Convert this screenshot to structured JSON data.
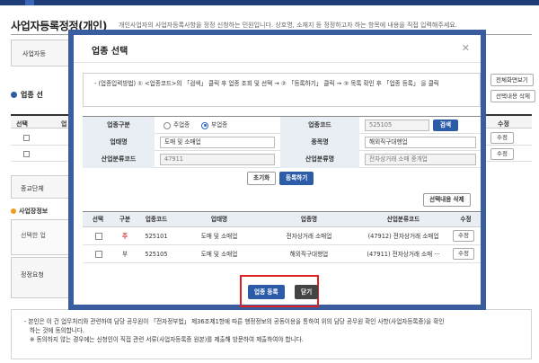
{
  "page": {
    "title": "사업자등록정정(개인)",
    "description": "개인사업자의 사업자등록사항을 정정 신청하는 민원입니다. 상호명, 소재지 등 정정하고자 하는 항목에 내용을 직접 입력해주세요."
  },
  "background": {
    "box1_label": "사업자등",
    "section_title": "업종 선",
    "preview_button": "전체화면보기",
    "delete_button": "선택내용 삭제",
    "table_headers": [
      "선택",
      "업"
    ],
    "edit_label": "수정",
    "box2_label": "종교단체",
    "section2_title": "사업장정보",
    "box3_label": "선택한 업",
    "box4_label": "정정요청"
  },
  "modal": {
    "title": "업종 선택",
    "close_icon": "close-icon",
    "guide_text": "- (업종입력방법) ① <업종코드>의 「검색」 클릭 후 업종 조회 및 선택 → ② 「등록하기」 클릭 → ③ 목록 확인 후 「업종 등록」 을 클릭",
    "form": {
      "type_label": "업종구분",
      "type_options": [
        "주업종",
        "부업종"
      ],
      "type_selected": "부업종",
      "code_label": "업종코드",
      "code_value": "525105",
      "search_button": "검색",
      "business_label": "업태명",
      "business_value": "도매 및 소매업",
      "item_label": "종목명",
      "item_value": "해외직구대행업",
      "industry_code_label": "산업분류코드",
      "industry_code_value": "47911",
      "industry_name_label": "산업분류명",
      "industry_name_value": "전자상거래 소매 중개업"
    },
    "reset_button": "초기화",
    "register_button": "등록하기",
    "delete_selected_button": "선택내용 삭제",
    "table": {
      "headers": [
        "선택",
        "구분",
        "업종코드",
        "업태명",
        "업종명",
        "산업분류코드",
        "수정"
      ],
      "rows": [
        {
          "type": "주",
          "code": "525101",
          "business": "도매 및 소매업",
          "item": "전자상거래 소매업",
          "industry": "(47912) 전자상거래 소매업",
          "edit": "수정"
        },
        {
          "type": "부",
          "code": "525105",
          "business": "도매 및 소매업",
          "item": "해외직구대행업",
          "industry": "(47911) 전자상거래 소매 ···",
          "edit": "수정"
        }
      ]
    },
    "submit_button": "업종 등록",
    "close_button": "닫기"
  },
  "notice": {
    "line1": "- 본인은 이 건 업무처리와 관련하여 담당 공무원이 「전자정부법」 제36조제1항에 따른 행정정보의 공동이용을 통하여 위의 담당 공무원 확인 사항(사업자등록증)을 확인",
    "line2": "하는 것에 동의합니다.",
    "line3": "※ 동의하지 않는 경우에는 신청인이 직접 관련 서류(사업자등록증 원본)를 제출해 방문하여 제출하여야 합니다."
  },
  "colors": {
    "modal_border": "#3a5d9f",
    "primary_button": "#2c5ca8",
    "highlight": "#e02020",
    "main_type": "#d62b2b"
  }
}
